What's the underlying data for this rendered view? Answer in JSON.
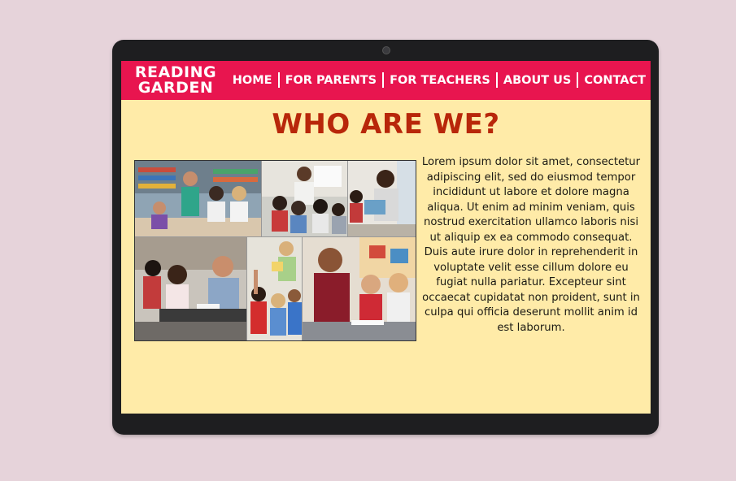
{
  "brand": {
    "line1": "READING",
    "line2": "GARDEN"
  },
  "nav": {
    "items": [
      {
        "label": "HOME"
      },
      {
        "label": "FOR PARENTS"
      },
      {
        "label": "FOR TEACHERS"
      },
      {
        "label": "ABOUT US"
      },
      {
        "label": "CONTACT"
      }
    ]
  },
  "main": {
    "heading": "WHO ARE WE?",
    "body": "Lorem ipsum dolor sit amet, consectetur adipiscing elit, sed do eiusmod tempor incididunt ut labore et dolore magna aliqua. Ut enim ad minim veniam, quis nostrud exercitation ullamco laboris nisi ut aliquip ex ea commodo consequat. Duis aute irure dolor in reprehenderit in voluptate velit esse cillum dolore eu fugiat nulla pariatur. Excepteur sint occaecat cupidatat non proident, sunt in culpa qui officia deserunt mollit anim id est laborum."
  },
  "colors": {
    "navbar": "#e8154f",
    "heading": "#b8270a",
    "screen_bg": "#ffeba8",
    "page_bg": "#e6d3da",
    "device": "#1e1e20"
  }
}
